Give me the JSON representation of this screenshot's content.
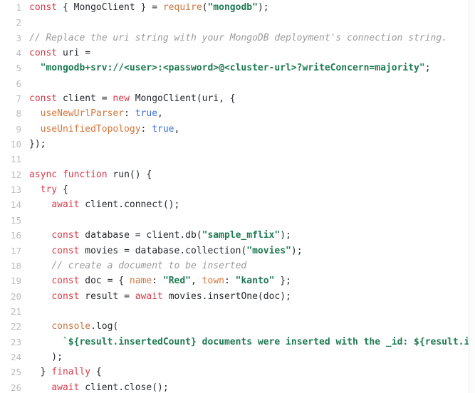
{
  "editor": {
    "language": "javascript",
    "background_color": "#ffffff",
    "gutter_color": "#bcbcbc",
    "text_color": "#24292e",
    "first_visible_line": 1,
    "last_visible_line": 26,
    "total_visible_lines": 26
  },
  "theme": {
    "keyword_color": "#d73a49",
    "string_color": "#1d7a52",
    "comment_color": "#9a9a9a",
    "function_color": "#c8743a",
    "property_color": "#d4763a",
    "constant_color": "#3b6fd4",
    "plain_color": "#24292e"
  },
  "lines": [
    {
      "number": "1",
      "tokens": [
        {
          "t": "const",
          "c": "keyword"
        },
        {
          "t": " ",
          "c": "plain"
        },
        {
          "t": "{ MongoClient } = ",
          "c": "plain"
        },
        {
          "t": "require",
          "c": "fn"
        },
        {
          "t": "(",
          "c": "plain"
        },
        {
          "t": "\"mongodb\"",
          "c": "string"
        },
        {
          "t": ");",
          "c": "plain"
        }
      ]
    },
    {
      "number": "2",
      "tokens": []
    },
    {
      "number": "3",
      "tokens": [
        {
          "t": "// Replace the uri string with your MongoDB deployment's connection string.",
          "c": "comment"
        }
      ]
    },
    {
      "number": "4",
      "tokens": [
        {
          "t": "const",
          "c": "keyword"
        },
        {
          "t": " uri =",
          "c": "plain"
        }
      ]
    },
    {
      "number": "5",
      "tokens": [
        {
          "t": "  ",
          "c": "plain"
        },
        {
          "t": "\"mongodb+srv://<user>:<password>@<cluster-url>?writeConcern=majority\"",
          "c": "string"
        },
        {
          "t": ";",
          "c": "plain"
        }
      ]
    },
    {
      "number": "6",
      "tokens": []
    },
    {
      "number": "7",
      "tokens": [
        {
          "t": "const",
          "c": "keyword"
        },
        {
          "t": " client = ",
          "c": "plain"
        },
        {
          "t": "new",
          "c": "keyword"
        },
        {
          "t": " MongoClient(uri, {",
          "c": "plain"
        }
      ]
    },
    {
      "number": "8",
      "tokens": [
        {
          "t": "  ",
          "c": "plain"
        },
        {
          "t": "useNewUrlParser",
          "c": "prop"
        },
        {
          "t": ": ",
          "c": "plain"
        },
        {
          "t": "true",
          "c": "const"
        },
        {
          "t": ",",
          "c": "plain"
        }
      ]
    },
    {
      "number": "9",
      "tokens": [
        {
          "t": "  ",
          "c": "plain"
        },
        {
          "t": "useUnifiedTopology",
          "c": "prop"
        },
        {
          "t": ": ",
          "c": "plain"
        },
        {
          "t": "true",
          "c": "const"
        },
        {
          "t": ",",
          "c": "plain"
        }
      ]
    },
    {
      "number": "10",
      "tokens": [
        {
          "t": "});",
          "c": "plain"
        }
      ]
    },
    {
      "number": "11",
      "tokens": []
    },
    {
      "number": "12",
      "tokens": [
        {
          "t": "async",
          "c": "keyword"
        },
        {
          "t": " ",
          "c": "plain"
        },
        {
          "t": "function",
          "c": "keyword"
        },
        {
          "t": " run() {",
          "c": "plain"
        }
      ]
    },
    {
      "number": "13",
      "tokens": [
        {
          "t": "  ",
          "c": "plain"
        },
        {
          "t": "try",
          "c": "keyword"
        },
        {
          "t": " {",
          "c": "plain"
        }
      ]
    },
    {
      "number": "14",
      "tokens": [
        {
          "t": "    ",
          "c": "plain"
        },
        {
          "t": "await",
          "c": "keyword"
        },
        {
          "t": " client.connect();",
          "c": "plain"
        }
      ]
    },
    {
      "number": "15",
      "tokens": []
    },
    {
      "number": "16",
      "tokens": [
        {
          "t": "    ",
          "c": "plain"
        },
        {
          "t": "const",
          "c": "keyword"
        },
        {
          "t": " database = client.db(",
          "c": "plain"
        },
        {
          "t": "\"sample_mflix\"",
          "c": "string"
        },
        {
          "t": ");",
          "c": "plain"
        }
      ]
    },
    {
      "number": "17",
      "tokens": [
        {
          "t": "    ",
          "c": "plain"
        },
        {
          "t": "const",
          "c": "keyword"
        },
        {
          "t": " movies = database.collection(",
          "c": "plain"
        },
        {
          "t": "\"movies\"",
          "c": "string"
        },
        {
          "t": ");",
          "c": "plain"
        }
      ]
    },
    {
      "number": "18",
      "tokens": [
        {
          "t": "    ",
          "c": "plain"
        },
        {
          "t": "// create a document to be inserted",
          "c": "comment"
        }
      ]
    },
    {
      "number": "19",
      "tokens": [
        {
          "t": "    ",
          "c": "plain"
        },
        {
          "t": "const",
          "c": "keyword"
        },
        {
          "t": " doc = { ",
          "c": "plain"
        },
        {
          "t": "name",
          "c": "prop"
        },
        {
          "t": ": ",
          "c": "plain"
        },
        {
          "t": "\"Red\"",
          "c": "string"
        },
        {
          "t": ", ",
          "c": "plain"
        },
        {
          "t": "town",
          "c": "prop"
        },
        {
          "t": ": ",
          "c": "plain"
        },
        {
          "t": "\"kanto\"",
          "c": "string"
        },
        {
          "t": " };",
          "c": "plain"
        }
      ]
    },
    {
      "number": "20",
      "tokens": [
        {
          "t": "    ",
          "c": "plain"
        },
        {
          "t": "const",
          "c": "keyword"
        },
        {
          "t": " result = ",
          "c": "plain"
        },
        {
          "t": "await",
          "c": "keyword"
        },
        {
          "t": " movies.insertOne(doc);",
          "c": "plain"
        }
      ]
    },
    {
      "number": "21",
      "tokens": []
    },
    {
      "number": "22",
      "tokens": [
        {
          "t": "    ",
          "c": "plain"
        },
        {
          "t": "console",
          "c": "fn"
        },
        {
          "t": ".log(",
          "c": "plain"
        }
      ]
    },
    {
      "number": "23",
      "tokens": [
        {
          "t": "      ",
          "c": "plain"
        },
        {
          "t": "`${result.insertedCount} documents were inserted with the _id: ${result.insertedId}",
          "c": "string"
        }
      ]
    },
    {
      "number": "24",
      "tokens": [
        {
          "t": "    );",
          "c": "plain"
        }
      ]
    },
    {
      "number": "25",
      "tokens": [
        {
          "t": "  } ",
          "c": "plain"
        },
        {
          "t": "finally",
          "c": "keyword"
        },
        {
          "t": " {",
          "c": "plain"
        }
      ]
    },
    {
      "number": "26",
      "tokens": [
        {
          "t": "    ",
          "c": "plain"
        },
        {
          "t": "await",
          "c": "keyword"
        },
        {
          "t": " client.close();",
          "c": "plain"
        }
      ]
    }
  ]
}
